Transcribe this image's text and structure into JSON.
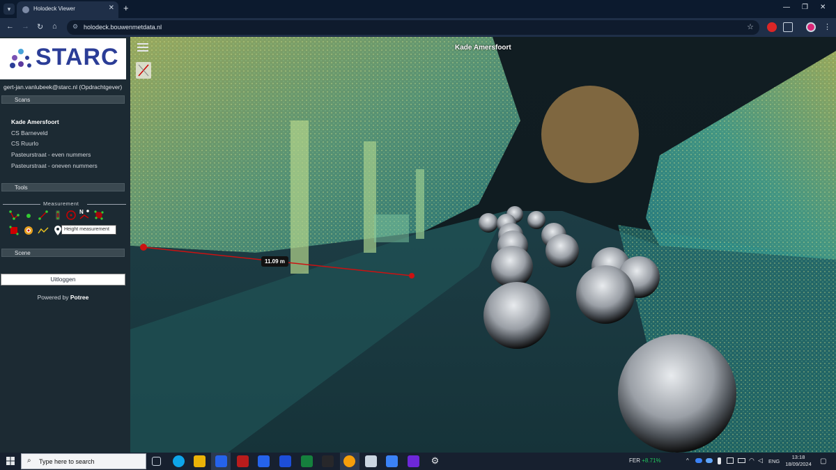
{
  "browser": {
    "tab_title": "Holodeck Viewer",
    "url": "holodeck.bouwenmetdata.nl"
  },
  "sidebar": {
    "logo_text": "STARC",
    "user": "gert-jan.vanlubeek@starc.nl (Opdrachtgever)",
    "sections": {
      "scans": "Scans",
      "tools": "Tools",
      "scene": "Scene"
    },
    "scans": [
      {
        "label": "Kade Amersfoort",
        "active": true
      },
      {
        "label": "CS Barneveld",
        "active": false
      },
      {
        "label": "CS Ruurlo",
        "active": false
      },
      {
        "label": "Pasteurstraat - even nummers",
        "active": false
      },
      {
        "label": "Pasteurstraat - oneven nummers",
        "active": false
      }
    ],
    "measurement_label": "Measurement",
    "tooltip": "Height measurement",
    "logout_label": "Uitloggen",
    "powered_prefix": "Powered by ",
    "powered_brand": "Potree"
  },
  "viewer": {
    "scene_title": "Kade Amersfoort",
    "distance_label": "11.09 m"
  },
  "taskbar": {
    "search_placeholder": "Type here to search",
    "stock_symbol": "FER",
    "stock_change": "+8.71%",
    "language": "ENG",
    "time": "13:18",
    "date": "18/09/2024"
  },
  "colors": {
    "accent_red": "#cc1111",
    "logo_blue": "#2b3d97",
    "sidebar_bg": "#1c2a33"
  }
}
